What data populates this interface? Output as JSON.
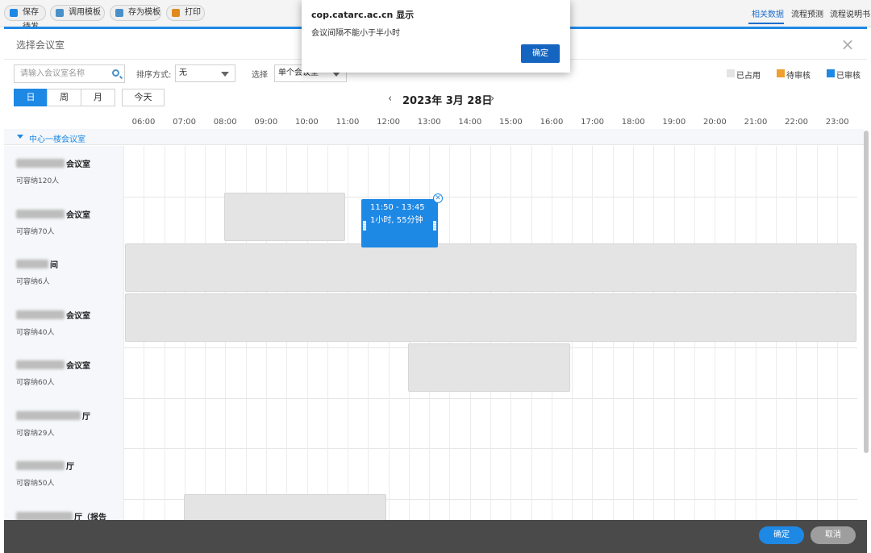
{
  "toolbar": {
    "buttons": [
      {
        "label": "保存待发",
        "color": "#1e88e5"
      },
      {
        "label": "调用模板",
        "color": "#4a90c8"
      },
      {
        "label": "存为模板",
        "color": "#4a90c8"
      },
      {
        "label": "打印",
        "color": "#e08a1e"
      }
    ],
    "right_tabs": [
      "相关数据",
      "流程预测",
      "流程说明书"
    ]
  },
  "modal": {
    "title": "选择会议室",
    "search_placeholder": "请输入会议室名称",
    "sort_label": "排序方式:",
    "sort_value": "无",
    "select_label": "选择",
    "select_value": "单个会议室",
    "legend": [
      {
        "label": "已占用",
        "color": "#e4e4e4"
      },
      {
        "label": "待审核",
        "color": "#f0a030"
      },
      {
        "label": "已审核",
        "color": "#1e88e5"
      }
    ],
    "views": [
      "日",
      "周",
      "月"
    ],
    "today": "今天",
    "date": "2023年 3月 28日",
    "prev": "‹",
    "next": "›",
    "hours": [
      "06:00",
      "07:00",
      "08:00",
      "09:00",
      "10:00",
      "11:00",
      "12:00",
      "13:00",
      "14:00",
      "15:00",
      "16:00",
      "17:00",
      "18:00",
      "19:00",
      "20:00",
      "21:00",
      "22:00",
      "23:00"
    ],
    "group": "中心一楼会议室",
    "rooms": [
      {
        "name": "会议室",
        "capacity": "可容纳120人"
      },
      {
        "name": "会议室",
        "capacity": "可容纳70人"
      },
      {
        "name": "间",
        "capacity": "可容纳6人"
      },
      {
        "name": "会议室",
        "capacity": "可容纳40人"
      },
      {
        "name": "会议室",
        "capacity": "可容纳60人"
      },
      {
        "name": "厅",
        "capacity": "可容纳29人"
      },
      {
        "name": "厅",
        "capacity": "可容纳50人"
      },
      {
        "name": "厅（报告",
        "capacity": ""
      }
    ],
    "event": {
      "time": "11:50 - 13:45",
      "duration": "1小时, 55分钟",
      "close": "✕"
    },
    "footer": {
      "ok": "确定",
      "cancel": "取消"
    }
  },
  "dialog": {
    "title": "cop.catarc.ac.cn 显示",
    "message": "会议间隔不能小于半小时",
    "ok": "确定"
  }
}
